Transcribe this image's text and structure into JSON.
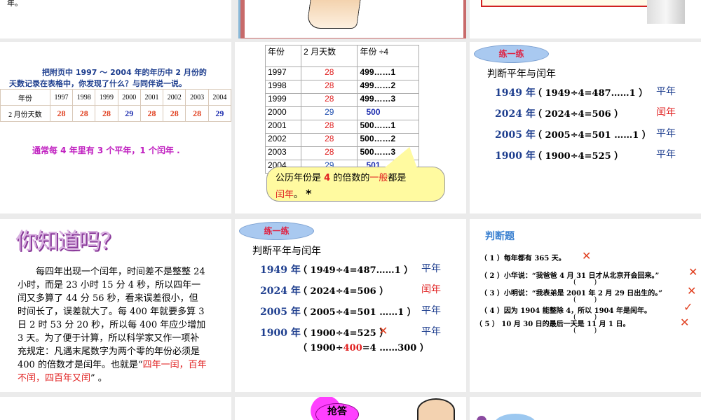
{
  "slide1": {
    "text": "年。"
  },
  "slide4": {
    "line1": "把附页中 1997 ～ 2004 年的年历中 2 月份的",
    "line2": "天数记录在表格中，你发现了什么？与同伴说一说。",
    "headers": [
      "年份",
      "1997",
      "1998",
      "1999",
      "2000",
      "2001",
      "2002",
      "2003",
      "2004"
    ],
    "row": [
      "2 月份天数",
      "28",
      "28",
      "28",
      "29",
      "28",
      "28",
      "28",
      "29"
    ],
    "conclusion": "通常每 4 年里有 3 个平年，1 个闰年 ."
  },
  "slide5": {
    "headers": [
      "年份",
      "2 月天数",
      "年份 ÷4"
    ],
    "rows": [
      [
        "1997",
        "28",
        "499……1"
      ],
      [
        "1998",
        "28",
        "499……2"
      ],
      [
        "1999",
        "28",
        "499……3"
      ],
      [
        "2000",
        "29",
        "500"
      ],
      [
        "2001",
        "28",
        "500……1"
      ],
      [
        "2002",
        "28",
        "500……2"
      ],
      [
        "2003",
        "28",
        "500……3"
      ],
      [
        "2004",
        "29",
        "501"
      ]
    ],
    "callout_a": "公历年份是 ",
    "callout_4": "4",
    "callout_b": " 的倍数的",
    "callout_c": "一般",
    "callout_d": "都是",
    "callout_e": "闰年",
    "callout_f": "。",
    "star": "*"
  },
  "slide6": {
    "badge": "练一练",
    "title": "判断平年与闰年",
    "items": [
      {
        "year": "1949 年",
        "calc": "（ 1949÷4=487……1 ）",
        "result": "平年"
      },
      {
        "year": "2024 年",
        "calc": "（ 2024÷4=506 ）",
        "result": "闰年"
      },
      {
        "year": "2005 年",
        "calc": "（ 2005÷4=501 ……1 ）",
        "result": "平年"
      },
      {
        "year": "1900 年",
        "calc": "（ 1900÷4=525 ）",
        "result": "平年"
      }
    ]
  },
  "slide7": {
    "title": "你知道吗？",
    "body": "每四年出现一个闰年，时间差不是整整 24 小时，而是 23 小时 15 分 4 秒，所以四年一闰又多算了 44 分 56 秒，看来误差很小，但时间长了，误差就大了。每 400 年就要多算 3 日 2 时 53 分 20 秒，所以每 400 年应少增加 3 天。为了便于计算，所以科学家又作一项补充规定：凡遇末尾数字为两个零的年份必须是 400 的倍数才是闰年。也就是“",
    "highlight": "四年一闰，百年不闰，四百年又闰",
    "end": "” 。"
  },
  "slide8": {
    "badge": "练一练",
    "title": "判断平年与闰年",
    "extra_a": "（ 1900÷",
    "extra_400": "400",
    "extra_b": "=4 ……300 ）",
    "mark": "✕"
  },
  "slide9": {
    "title": "判断题",
    "items": [
      {
        "text": "（ 1 ）每年都有 365 天。",
        "mark": "✕"
      },
      {
        "text": "（ 2 ）小华说：“我爸爸 4 月 31 日才从北京开会回来。”",
        "mark": "✕"
      },
      {
        "text": "（ 3 ）小明说：“我表弟是 2001 年 2 月 29 日出生的。”",
        "mark": "✕"
      },
      {
        "text": "（ 4 ）因为 1904 能整除 4，所以 1904 年是闰年。",
        "mark": "✓"
      },
      {
        "text": "（ 5 ） 10 月 30 日的最后一天是 11 月 1 日。",
        "mark": "✕"
      }
    ],
    "paren": "(        )"
  },
  "slide11": {
    "badge": "抢答"
  },
  "colors": {
    "blue": "#1f3f8f",
    "red": "#e02020",
    "magenta": "#c020c0",
    "pill": "#a9c9f0"
  }
}
